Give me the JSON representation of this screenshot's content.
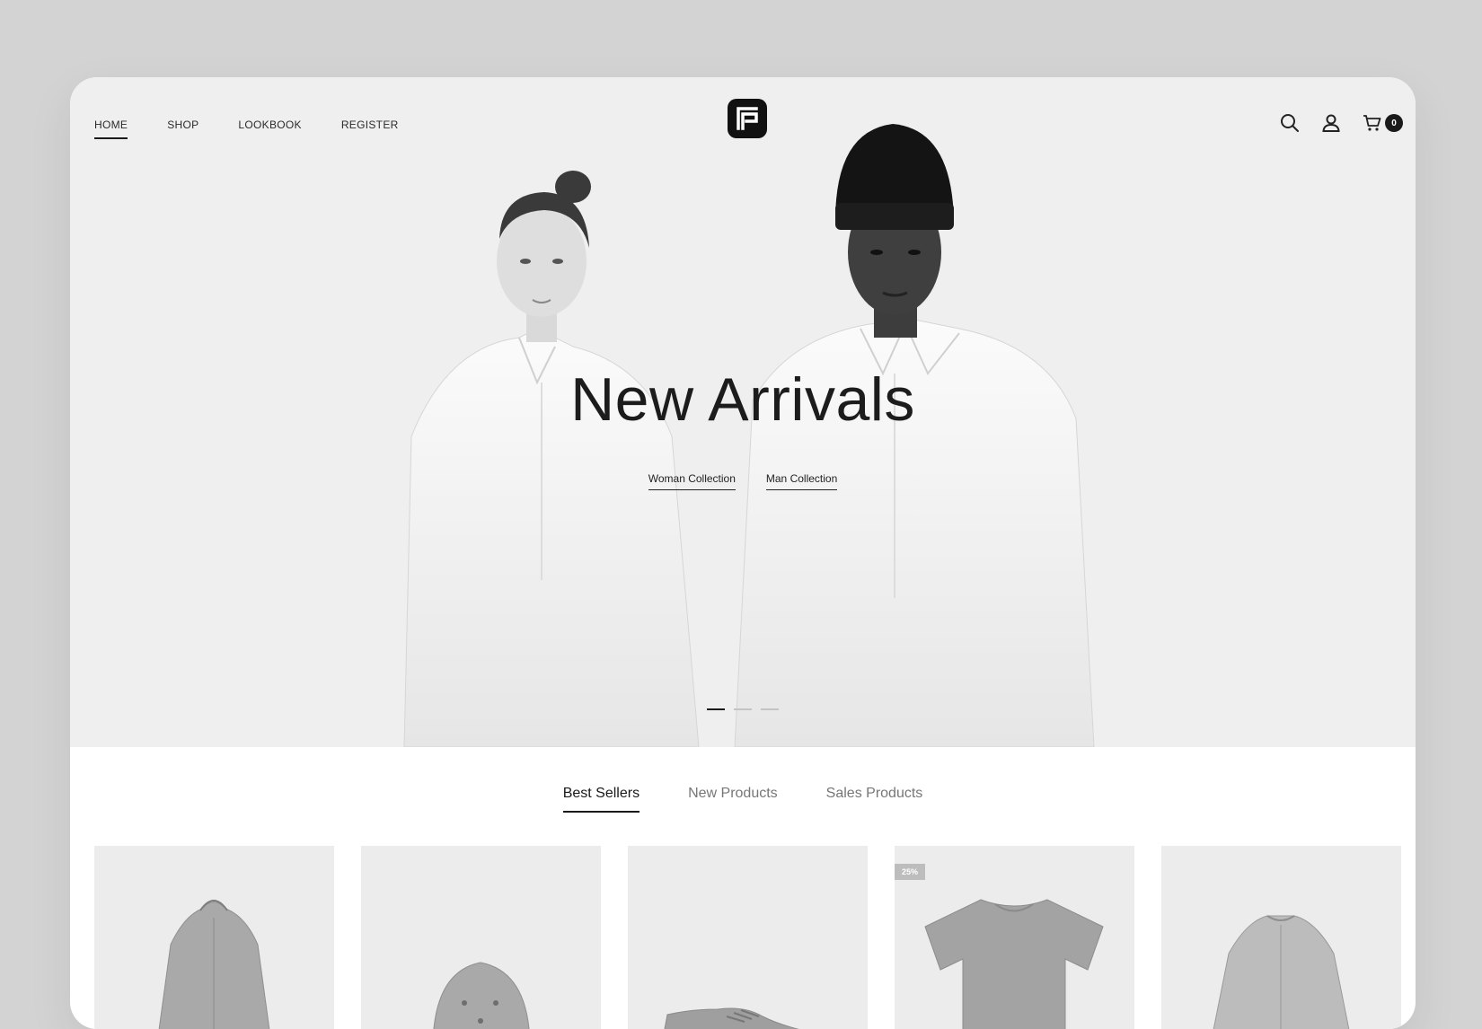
{
  "nav": {
    "items": [
      {
        "label": "HOME",
        "active": true
      },
      {
        "label": "SHOP",
        "active": false
      },
      {
        "label": "LOOKBOOK",
        "active": false
      },
      {
        "label": "REGISTER",
        "active": false
      }
    ]
  },
  "logo": {
    "icon": "brand-logo-icon"
  },
  "header_icons": {
    "search": "search-icon",
    "account": "user-icon",
    "cart": "cart-icon",
    "cart_count": "0"
  },
  "hero": {
    "title": "New Arrivals",
    "links": [
      "Woman Collection",
      "Man Collection"
    ],
    "slides": {
      "count": 3,
      "active_index": 0
    }
  },
  "tabs": [
    {
      "label": "Best Sellers",
      "active": true
    },
    {
      "label": "New Products",
      "active": false
    },
    {
      "label": "Sales Products",
      "active": false
    }
  ],
  "products": [
    {
      "type": "hooded-jacket"
    },
    {
      "type": "cap"
    },
    {
      "type": "sneaker"
    },
    {
      "type": "t-shirt",
      "badge": "25%"
    },
    {
      "type": "jacket"
    }
  ],
  "colors": {
    "background": "#d3d3d3",
    "hero_background": "#efefef",
    "accent": "#1a1a1a",
    "card_background": "#ececec"
  }
}
